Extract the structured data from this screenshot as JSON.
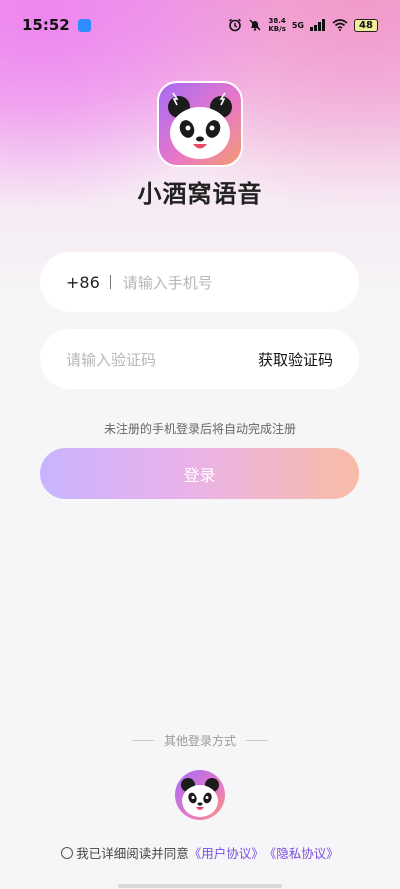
{
  "status_bar": {
    "time": "15:52",
    "net_speed_top": "38.4",
    "net_speed_bottom": "KB/s",
    "network_type": "5G",
    "battery": "48"
  },
  "app": {
    "name": "小酒窝语音"
  },
  "login_form": {
    "country_code": "+86",
    "phone_placeholder": "请输入手机号",
    "code_placeholder": "请输入验证码",
    "get_code_label": "获取验证码",
    "notice": "未注册的手机登录后将自动完成注册",
    "login_label": "登录"
  },
  "other_login": {
    "title": "其他登录方式"
  },
  "agreement": {
    "prefix": "我已详细阅读并同意",
    "user_agreement": "《用户协议》",
    "privacy_policy": "《隐私协议》"
  }
}
